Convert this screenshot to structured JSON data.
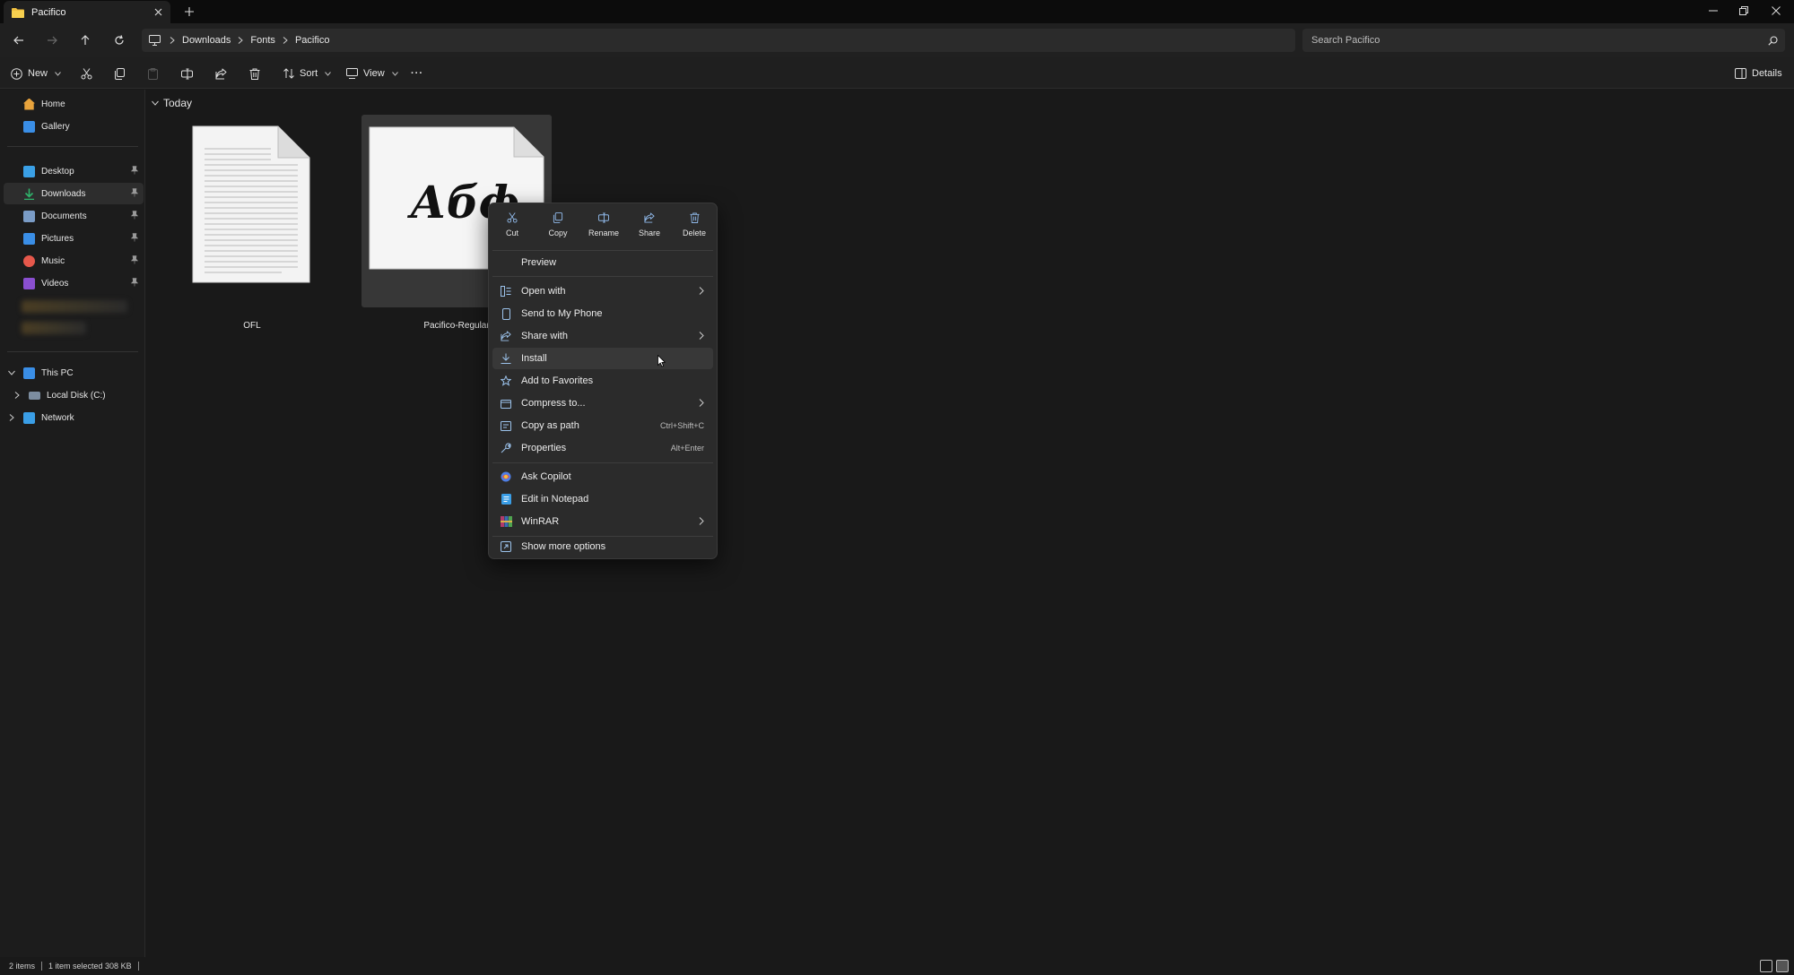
{
  "window": {
    "tab_title": "Pacifico",
    "minimize_glyph": "–",
    "restore_glyph": "❐",
    "close_glyph": "✕"
  },
  "address": {
    "breadcrumbs": [
      "Downloads",
      "Fonts",
      "Pacifico"
    ],
    "search_placeholder": "Search Pacifico"
  },
  "commandbar": {
    "new_label": "New",
    "sort_label": "Sort",
    "view_label": "View",
    "more_label": "···",
    "details_label": "Details"
  },
  "sidebar": {
    "quick": [
      {
        "label": "Home",
        "icon": "home-icon",
        "color": "#e8a33c"
      },
      {
        "label": "Gallery",
        "icon": "gallery-icon",
        "color": "#3a8ee6"
      }
    ],
    "pinned": [
      {
        "label": "Desktop",
        "icon": "desktop-icon",
        "color": "#3aa0e6"
      },
      {
        "label": "Downloads",
        "icon": "downloads-icon",
        "color": "#2fb36b"
      },
      {
        "label": "Documents",
        "icon": "documents-icon",
        "color": "#7a9cc6"
      },
      {
        "label": "Pictures",
        "icon": "pictures-icon",
        "color": "#3a8ee6"
      },
      {
        "label": "Music",
        "icon": "music-icon",
        "color": "#e6584b"
      },
      {
        "label": "Videos",
        "icon": "videos-icon",
        "color": "#8a4fd0"
      }
    ],
    "tree": {
      "this_pc": "This PC",
      "local_disk": "Local Disk (C:)",
      "network": "Network"
    }
  },
  "content": {
    "group_label": "Today",
    "files": [
      {
        "name": "OFL",
        "type": "text-document"
      },
      {
        "name": "Pacifico-Regular",
        "type": "font-file",
        "preview_text": "Абф"
      }
    ]
  },
  "context_menu": {
    "quick_actions": [
      {
        "label": "Cut",
        "icon": "cut-icon"
      },
      {
        "label": "Copy",
        "icon": "copy-icon"
      },
      {
        "label": "Rename",
        "icon": "rename-icon"
      },
      {
        "label": "Share",
        "icon": "share-icon"
      },
      {
        "label": "Delete",
        "icon": "delete-icon"
      }
    ],
    "preview_label": "Preview",
    "items": [
      {
        "label": "Open with",
        "shortcut": ""
      },
      {
        "label": "Send to My Phone",
        "shortcut": ""
      },
      {
        "label": "Share with",
        "shortcut": ""
      },
      {
        "label": "Install",
        "shortcut": ""
      },
      {
        "label": "Add to Favorites",
        "shortcut": ""
      },
      {
        "label": "Compress to...",
        "shortcut": ""
      },
      {
        "label": "Copy as path",
        "shortcut": "Ctrl+Shift+C"
      },
      {
        "label": "Properties",
        "shortcut": "Alt+Enter"
      }
    ],
    "apps": [
      {
        "label": "Ask Copilot"
      },
      {
        "label": "Edit in Notepad"
      },
      {
        "label": "WinRAR"
      }
    ],
    "show_more": "Show more options"
  },
  "status": {
    "item_count": "2 items",
    "selection": "1 item selected  308 KB"
  }
}
